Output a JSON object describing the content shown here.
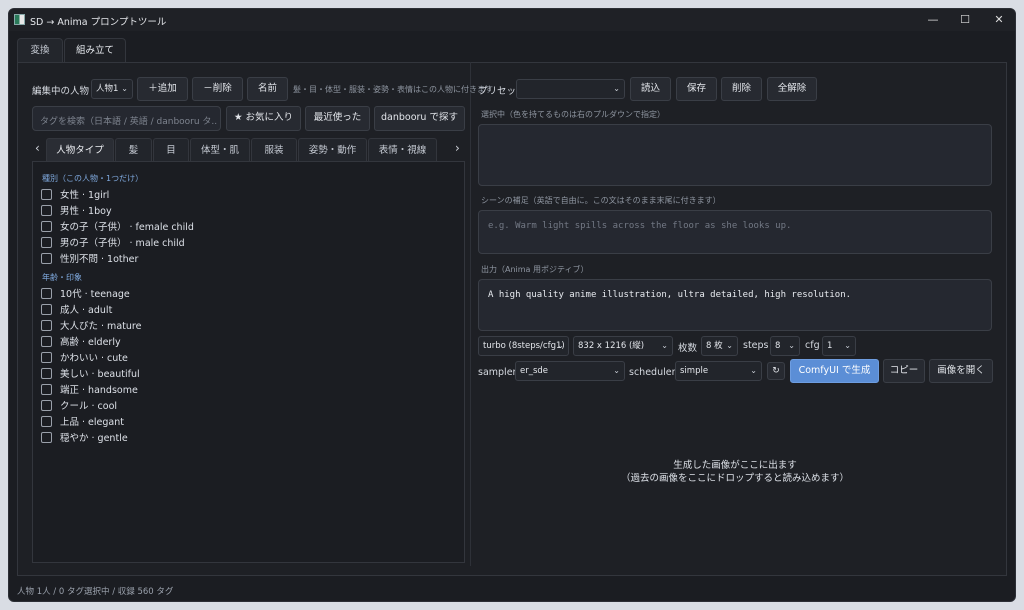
{
  "window": {
    "title": "SD → Anima プロンプトツール",
    "controls": [
      "—",
      "☐",
      "✕"
    ]
  },
  "top_tabs": [
    {
      "label": "変換",
      "active": false
    },
    {
      "label": "組み立て",
      "active": true
    }
  ],
  "left": {
    "editing_label": "編集中の人物",
    "person_select": "人物1",
    "add_button": "＋追加",
    "remove_button": "－削除",
    "name_button": "名前",
    "hint": "髪・目・体型・服装・姿勢・表情はこの人物に付きます",
    "search_placeholder": "タグを検索（日本語 / 英語 / danbooru タ...",
    "favorites_button": "★ お気に入り",
    "recent_button": "最近使った",
    "danbooru_button": "danbooru で探す",
    "category_tabs": [
      "人物タイプ",
      "髪",
      "目",
      "体型・肌",
      "服装",
      "姿勢・動作",
      "表情・視線"
    ],
    "nav_left": "‹",
    "nav_right": "›",
    "sections": [
      {
        "title": "種別（この人物・1つだけ）",
        "items": [
          "女性 · 1girl",
          "男性 · 1boy",
          "女の子（子供） · female child",
          "男の子（子供） · male child",
          "性別不問 · 1other"
        ]
      },
      {
        "title": "年齢・印象",
        "items": [
          "10代 · teenage",
          "成人 · adult",
          "大人びた · mature",
          "高齢 · elderly",
          "かわいい · cute",
          "美しい · beautiful",
          "端正 · handsome",
          "クール · cool",
          "上品 · elegant",
          "穏やか · gentle"
        ]
      }
    ]
  },
  "right": {
    "preset_label": "プリセット",
    "preset_value": "",
    "load_button": "読込",
    "save_button": "保存",
    "delete_button": "削除",
    "clear_button": "全解除",
    "selected_label": "選択中（色を持てるものは右のプルダウンで指定）",
    "scene_label": "シーンの補足（英語で自由に。この文はそのまま末尾に付きます）",
    "scene_placeholder": "e.g. Warm light spills across the floor as she looks up.",
    "output_label": "出力（Anima 用ポジティブ）",
    "output_text": "A high quality anime illustration, ultra detailed, high resolution.",
    "mode_select": "turbo (8steps/cfg1)",
    "size_select": "832 x 1216 (縦)",
    "count_label": "枚数",
    "count_select": "8 枚",
    "steps_label": "steps",
    "steps_select": "8",
    "cfg_label": "cfg",
    "cfg_select": "1",
    "sampler_label": "sampler",
    "sampler_select": "er_sde",
    "scheduler_label": "scheduler",
    "scheduler_select": "simple",
    "refresh_icon": "↻",
    "generate_button": "ComfyUI で生成",
    "copy_button": "コピー",
    "open_image_button": "画像を開く",
    "image_msg_1": "生成した画像がここに出ます",
    "image_msg_2": "（過去の画像をここにドロップすると読み込めます）"
  },
  "status": "人物 1人 / 0 タグ選択中 / 収録 560 タグ"
}
